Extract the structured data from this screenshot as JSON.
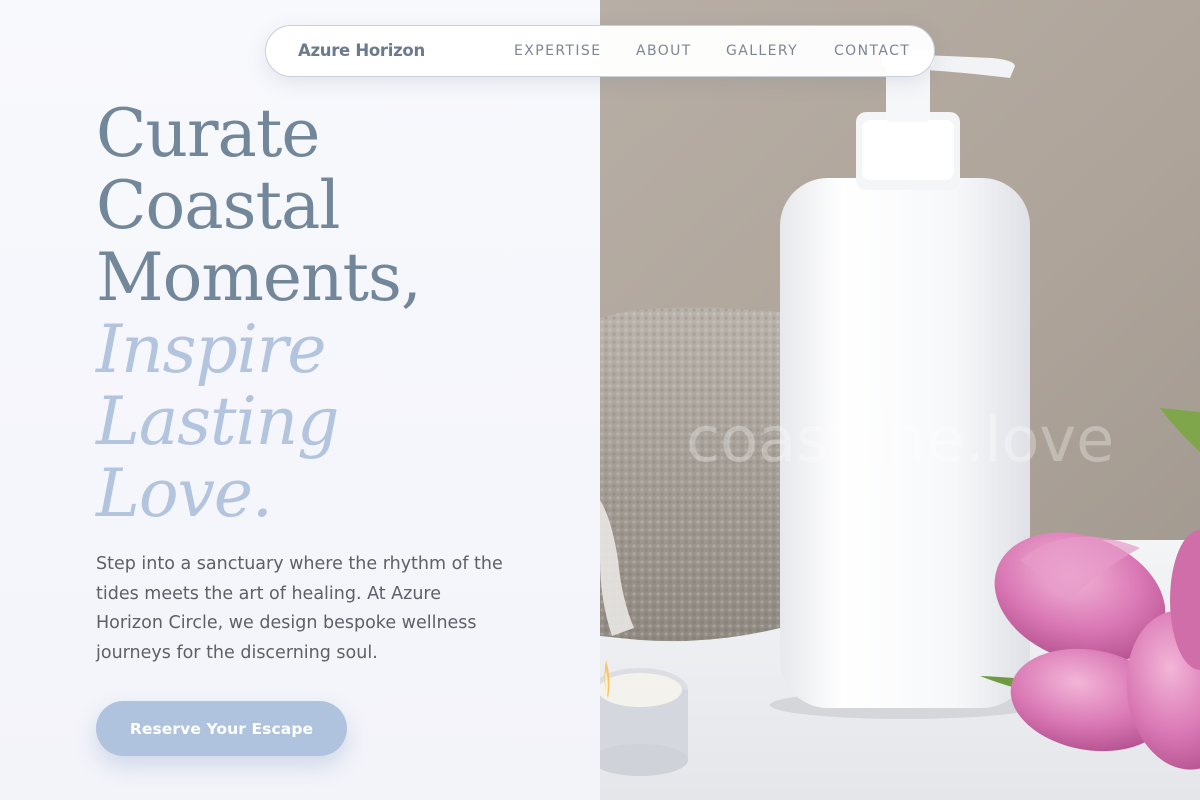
{
  "nav": {
    "brand": "Azure Horizon",
    "links": [
      "EXPERTISE",
      "ABOUT",
      "GALLERY",
      "CONTACT"
    ]
  },
  "hero": {
    "headline_plain": [
      "Curate",
      "Coastal",
      "Moments,"
    ],
    "headline_accent": [
      "Inspire",
      "Lasting",
      "Love."
    ],
    "description": "Step into a sanctuary where the rhythm of the tides meets the art of healing. At Azure Horizon Circle, we design bespoke wellness journeys for the discerning soul.",
    "cta_label": "Reserve Your Escape",
    "watermark": "coastline.love"
  },
  "colors": {
    "headline": "#73879b",
    "headline_accent": "#b2c4de",
    "button": "#afc3de",
    "background": "#f5f6fb"
  }
}
